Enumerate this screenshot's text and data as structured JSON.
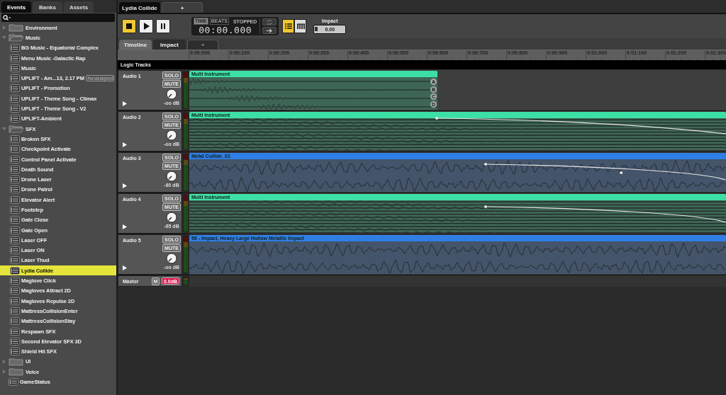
{
  "event_tabs": [
    {
      "label": "Lydia Collide",
      "selected": true
    },
    {
      "label": "+",
      "selected": false
    }
  ],
  "browser": {
    "tabs": [
      {
        "label": "Events",
        "selected": true
      },
      {
        "label": "Banks",
        "selected": false
      },
      {
        "label": "Assets",
        "selected": false
      }
    ],
    "tree": [
      {
        "kind": "folder",
        "label": "Environment",
        "expanded": false,
        "selected": false
      },
      {
        "kind": "folder",
        "label": "Music",
        "expanded": true,
        "selected": false,
        "children": [
          {
            "kind": "event",
            "label": "BG Music - Equatorial Complex",
            "selected": false
          },
          {
            "kind": "event",
            "label": "Menu Music -Galactic Rap",
            "selected": false
          },
          {
            "kind": "event",
            "label": "Music",
            "selected": false
          },
          {
            "kind": "event",
            "label": "UPLIFT - Am...13, 2.17 PM",
            "badge": "#unassigned",
            "selected": false
          },
          {
            "kind": "event",
            "label": "UPLIFT - Promotion",
            "selected": false
          },
          {
            "kind": "event",
            "label": "UPLIFT - Theme Song - Climax",
            "selected": false
          },
          {
            "kind": "event",
            "label": "UPLIFT - Theme Song - V2",
            "selected": false
          },
          {
            "kind": "event",
            "label": "UPLIFT-Ambient",
            "selected": false
          }
        ]
      },
      {
        "kind": "folder",
        "label": "SFX",
        "expanded": true,
        "selected": false,
        "children": [
          {
            "kind": "event",
            "label": "Broken SFX",
            "selected": false
          },
          {
            "kind": "event",
            "label": "Checkpoint Activate",
            "selected": false
          },
          {
            "kind": "event",
            "label": "Control Panel Activate",
            "selected": false
          },
          {
            "kind": "event",
            "label": "Death Sound",
            "selected": false
          },
          {
            "kind": "event",
            "label": "Drone Laser",
            "selected": false
          },
          {
            "kind": "event",
            "label": "Drone Patrol",
            "selected": false
          },
          {
            "kind": "event",
            "label": "Elevator Alert",
            "selected": false
          },
          {
            "kind": "event",
            "label": "Footstep",
            "selected": false
          },
          {
            "kind": "event",
            "label": "Gate Close",
            "selected": false
          },
          {
            "kind": "event",
            "label": "Gate Open",
            "selected": false
          },
          {
            "kind": "event",
            "label": "Laser OFF",
            "selected": false
          },
          {
            "kind": "event",
            "label": "Laser ON",
            "selected": false
          },
          {
            "kind": "event",
            "label": "Laser Thud",
            "selected": false
          },
          {
            "kind": "event",
            "label": "Lydia Collide",
            "selected": true
          },
          {
            "kind": "event",
            "label": "Maglove Click",
            "selected": false
          },
          {
            "kind": "event",
            "label": "Magloves Attract 2D",
            "selected": false
          },
          {
            "kind": "event",
            "label": "Magloves Repulse 2D",
            "selected": false
          },
          {
            "kind": "event",
            "label": "MattressCollisionEnter",
            "selected": false
          },
          {
            "kind": "event",
            "label": "MattressCollisionStay",
            "selected": false
          },
          {
            "kind": "event",
            "label": "Respawn SFX",
            "selected": false
          },
          {
            "kind": "event",
            "label": "Second Elevator SFX 3D",
            "selected": false
          },
          {
            "kind": "event",
            "label": "Shield Hit SFX",
            "selected": false
          }
        ]
      },
      {
        "kind": "folder",
        "label": "UI",
        "expanded": false,
        "selected": false
      },
      {
        "kind": "folder",
        "label": "Voice",
        "expanded": false,
        "selected": false
      },
      {
        "kind": "event",
        "label": "GameStatus",
        "selected": false
      }
    ]
  },
  "transport": {
    "buttons": [
      {
        "kind": "stop",
        "on": true
      },
      {
        "kind": "play",
        "on": false
      },
      {
        "kind": "pause",
        "on": false
      }
    ],
    "time_modes": [
      {
        "label": "TIME",
        "selected": true
      },
      {
        "label": "BEATS",
        "selected": false
      }
    ],
    "state": "STOPPED",
    "time": "00:00.000",
    "views": [
      {
        "kind": "list",
        "selected": true
      },
      {
        "kind": "grid",
        "selected": false
      }
    ]
  },
  "parameter": {
    "label": "Impact",
    "value": "0.00",
    "level": 0
  },
  "editor_tabs": [
    {
      "label": "Timeline",
      "selected": true
    },
    {
      "label": "Impact",
      "selected": false
    },
    {
      "label": "+",
      "selected": false
    }
  ],
  "ruler": {
    "ticks": [
      "0:00:000",
      "0:00:100",
      "0:00:200",
      "0:00:300",
      "0:00:400",
      "0:00:500",
      "0:00:600",
      "0:00:700",
      "0:00:800",
      "0:00:900",
      "0:01:000",
      "0:01:100",
      "0:01:200",
      "0:01:300"
    ]
  },
  "logic_tracks": {
    "label": "Logic Tracks"
  },
  "tracks": [
    {
      "name": "Audio 1",
      "solo": "SOLO",
      "mute": "MUTE",
      "volume": "-oo dB",
      "automation": false,
      "clip": {
        "kind": "multi",
        "label": "Multi Instrument",
        "cut_off": false,
        "lanes": [
          "A",
          "B",
          "C",
          "D"
        ]
      }
    },
    {
      "name": "Audio 2",
      "solo": "SOLO",
      "mute": "MUTE",
      "volume": "-oo dB",
      "automation": true,
      "clip": {
        "kind": "multi",
        "label": "Multi Instrument",
        "cut_off": true
      }
    },
    {
      "name": "Audio 3",
      "solo": "SOLO",
      "mute": "MUTE",
      "volume": "-60 dB",
      "automation": true,
      "clip": {
        "kind": "single",
        "label": "Metal Collide_01",
        "cut_off": true
      }
    },
    {
      "name": "Audio 4",
      "solo": "SOLO",
      "mute": "MUTE",
      "volume": "-65 dB",
      "automation": true,
      "clip": {
        "kind": "multi",
        "label": "Multi Instrument",
        "cut_off": true
      }
    },
    {
      "name": "Audio 5",
      "solo": "SOLO",
      "mute": "MUTE",
      "volume": "-oo dB",
      "automation": false,
      "clip": {
        "kind": "single",
        "label": "56 - Impact, Heavy Large Hollow Metallic Impact",
        "cut_off": true
      }
    }
  ],
  "master": {
    "name": "Master",
    "mute": "M",
    "volume": "0.0dB"
  }
}
